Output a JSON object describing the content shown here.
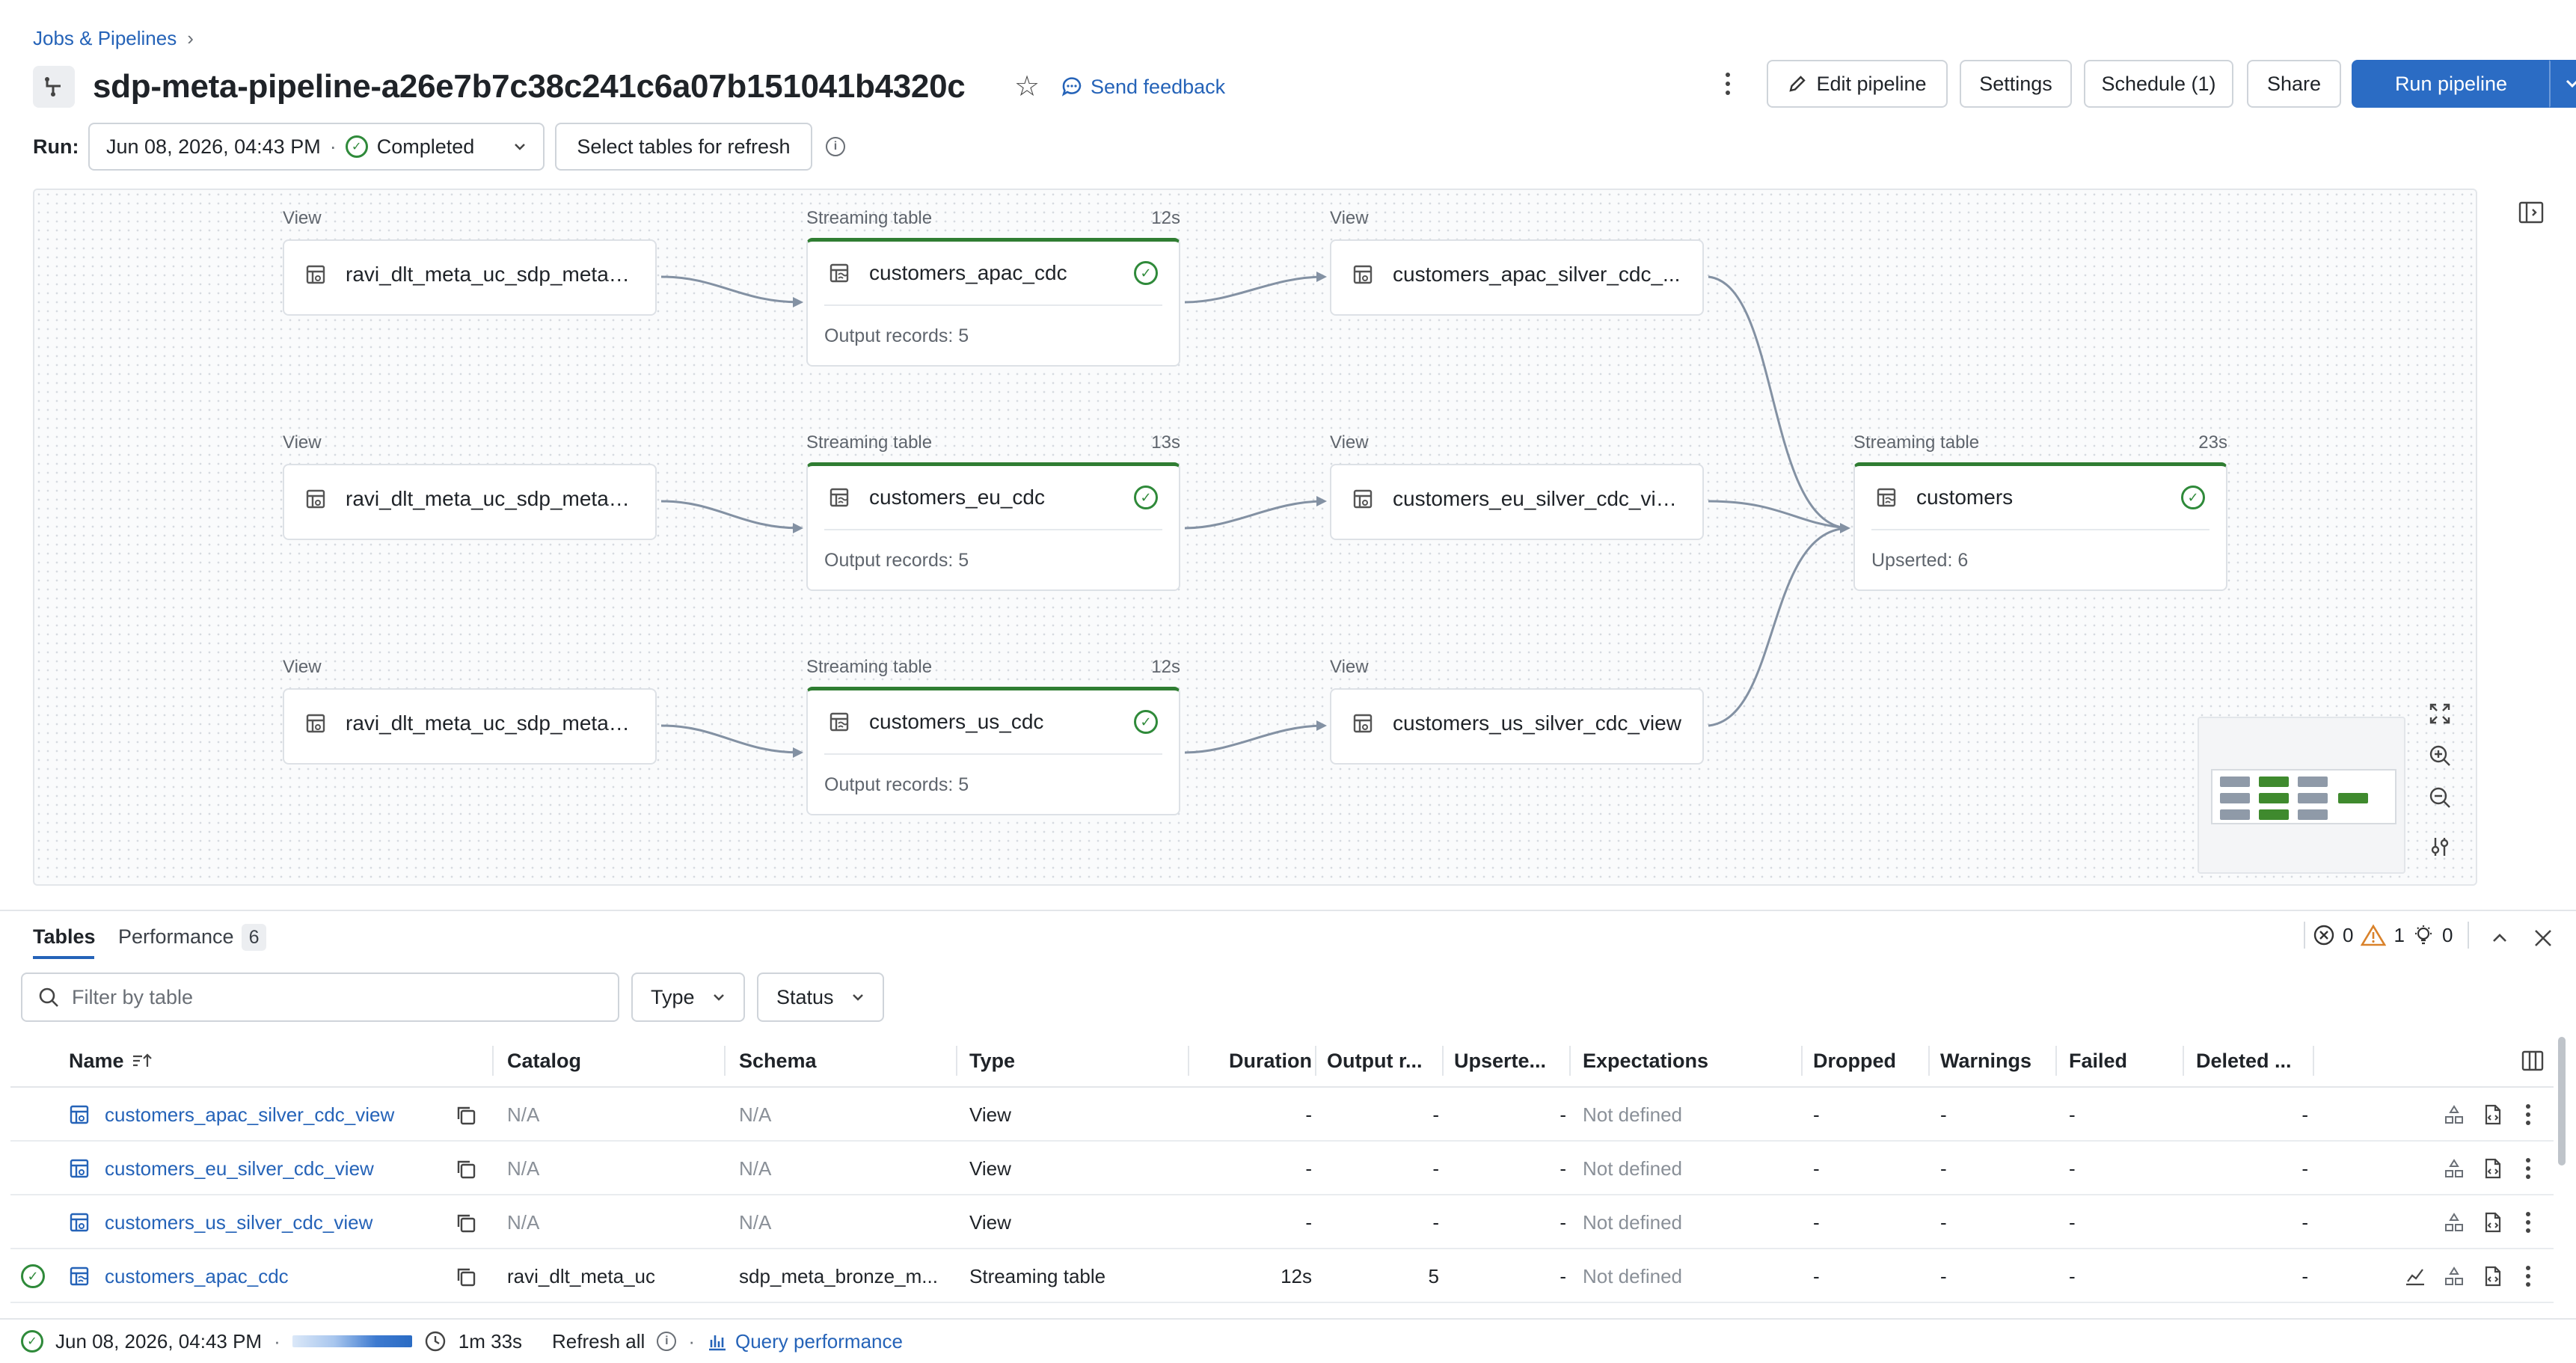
{
  "breadcrumb": {
    "parent": "Jobs & Pipelines"
  },
  "pipeline": {
    "title": "sdp-meta-pipeline-a26e7b7c38c241c6a07b151041b4320c"
  },
  "header": {
    "feedback_label": "Send feedback",
    "edit_label": "Edit pipeline",
    "settings_label": "Settings",
    "schedule_label": "Schedule (1)",
    "share_label": "Share",
    "run_label": "Run pipeline"
  },
  "run": {
    "label": "Run:",
    "datetime": "Jun 08, 2026, 04:43 PM",
    "separator": "·",
    "status": "Completed",
    "refresh_button": "Select tables for refresh"
  },
  "graph": {
    "nodes": [
      {
        "kind": "View",
        "name": "ravi_dlt_meta_uc_sdp_meta_...",
        "time": ""
      },
      {
        "kind": "Streaming table",
        "name": "customers_apac_cdc",
        "time": "12s",
        "stat": "Output records: 5"
      },
      {
        "kind": "View",
        "name": "customers_apac_silver_cdc_...",
        "time": ""
      },
      {
        "kind": "View",
        "name": "ravi_dlt_meta_uc_sdp_meta_...",
        "time": ""
      },
      {
        "kind": "Streaming table",
        "name": "customers_eu_cdc",
        "time": "13s",
        "stat": "Output records: 5"
      },
      {
        "kind": "View",
        "name": "customers_eu_silver_cdc_view",
        "time": ""
      },
      {
        "kind": "View",
        "name": "ravi_dlt_meta_uc_sdp_meta_...",
        "time": ""
      },
      {
        "kind": "Streaming table",
        "name": "customers_us_cdc",
        "time": "12s",
        "stat": "Output records: 5"
      },
      {
        "kind": "View",
        "name": "customers_us_silver_cdc_view",
        "time": ""
      },
      {
        "kind": "Streaming table",
        "name": "customers",
        "time": "23s",
        "stat": "Upserted: 6"
      }
    ]
  },
  "panel": {
    "tab_tables": "Tables",
    "tab_performance": "Performance",
    "performance_count": "6",
    "errors": "0",
    "warnings": "1",
    "suggestions": "0",
    "filter_placeholder": "Filter by table",
    "type_filter": "Type",
    "status_filter": "Status"
  },
  "table": {
    "columns": [
      "Name",
      "Catalog",
      "Schema",
      "Type",
      "Duration",
      "Output r...",
      "Upserte...",
      "Expectations",
      "Dropped",
      "Warnings",
      "Failed",
      "Deleted ..."
    ],
    "rows": [
      {
        "name": "customers_apac_silver_cdc_view",
        "catalog": "N/A",
        "schema": "N/A",
        "type": "View",
        "duration": "-",
        "output": "-",
        "upserted": "-",
        "expectations": "Not defined",
        "dropped": "-",
        "warnings": "-",
        "failed": "-",
        "deleted": "-"
      },
      {
        "name": "customers_eu_silver_cdc_view",
        "catalog": "N/A",
        "schema": "N/A",
        "type": "View",
        "duration": "-",
        "output": "-",
        "upserted": "-",
        "expectations": "Not defined",
        "dropped": "-",
        "warnings": "-",
        "failed": "-",
        "deleted": "-"
      },
      {
        "name": "customers_us_silver_cdc_view",
        "catalog": "N/A",
        "schema": "N/A",
        "type": "View",
        "duration": "-",
        "output": "-",
        "upserted": "-",
        "expectations": "Not defined",
        "dropped": "-",
        "warnings": "-",
        "failed": "-",
        "deleted": "-"
      },
      {
        "name": "customers_apac_cdc",
        "catalog": "ravi_dlt_meta_uc",
        "schema": "sdp_meta_bronze_m...",
        "type": "Streaming table",
        "duration": "12s",
        "output": "5",
        "upserted": "-",
        "expectations": "Not defined",
        "dropped": "-",
        "warnings": "-",
        "failed": "-",
        "deleted": "-"
      }
    ]
  },
  "footer": {
    "datetime": "Jun 08, 2026, 04:43 PM",
    "separator": "·",
    "duration": "1m 33s",
    "refresh_all": "Refresh all",
    "query_performance": "Query performance"
  },
  "colors": {
    "accent": "#2b6cc4",
    "success": "#2f8a3a",
    "warning": "#d9822b",
    "link": "#2563b8"
  }
}
